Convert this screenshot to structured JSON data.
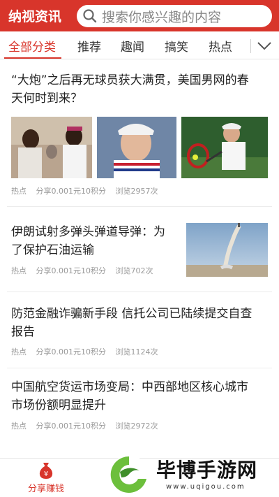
{
  "header": {
    "app_title": "纳视资讯",
    "search_placeholder": "搜索你感兴趣的内容"
  },
  "tabs": [
    {
      "label": "全部分类",
      "active": true
    },
    {
      "label": "推荐",
      "active": false
    },
    {
      "label": "趣闻",
      "active": false
    },
    {
      "label": "搞笑",
      "active": false
    },
    {
      "label": "热点",
      "active": false
    }
  ],
  "articles": [
    {
      "title_line1": "“大炮”之后再无球员获大满贯，美国男网的春",
      "title_line2": "天何时到来？",
      "tag": "热点",
      "share": "分享0.001元10积分",
      "views": "浏览2957次"
    },
    {
      "title_line1": "伊朗试射多弹头弹道导弹：为",
      "title_line2": "了保护石油运输",
      "tag": "热点",
      "share": "分享0.001元10积分",
      "views": "浏览702次"
    },
    {
      "title_line1": "防范金融诈骗新手段 信托公司已陆续提交自查",
      "title_line2": "报告",
      "tag": "热点",
      "share": "分享0.001元10积分",
      "views": "浏览1124次"
    },
    {
      "title_line1": "中国航空货运市场变局：中西部地区核心城市",
      "title_line2": "市场份额明显提升",
      "tag": "热点",
      "share": "分享0.001元10积分",
      "views": "浏览2972次"
    }
  ],
  "bottom_nav": {
    "share_earn_label": "分享赚钱"
  },
  "watermark": {
    "brand": "毕博手游网",
    "url": "www.uqigou.com"
  },
  "colors": {
    "brand_red": "#d8352b",
    "meta_gray": "#999999"
  }
}
